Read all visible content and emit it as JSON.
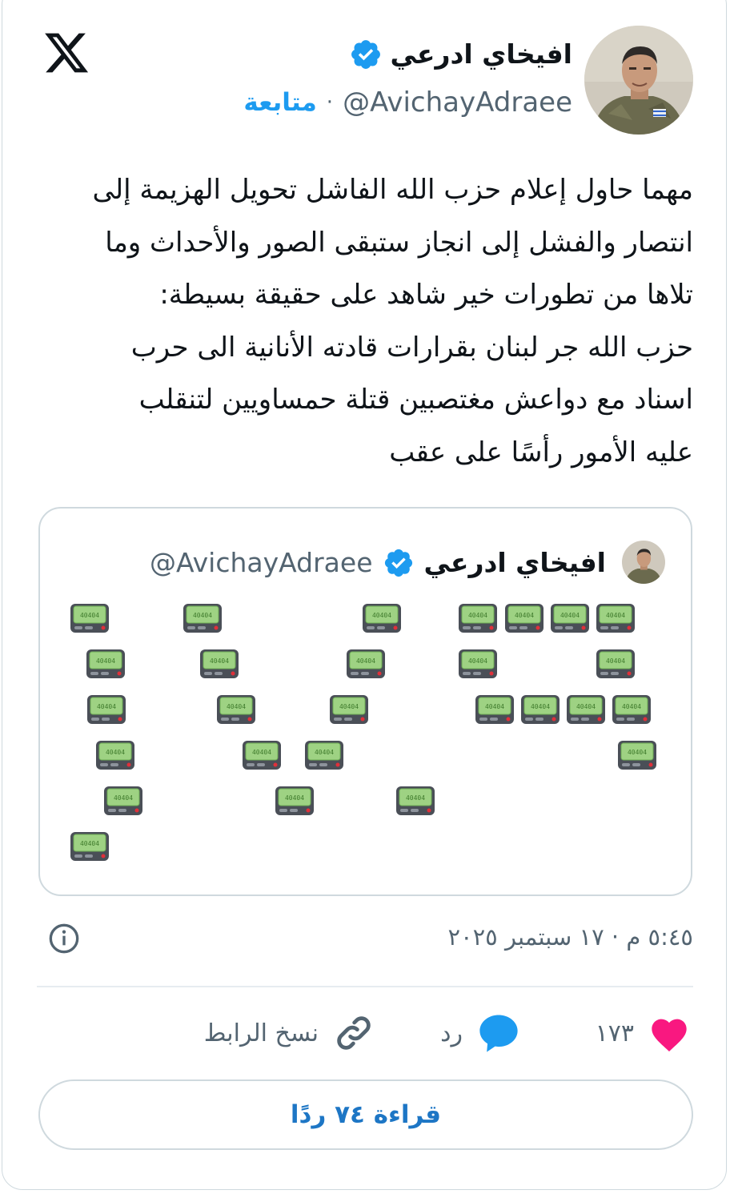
{
  "author": {
    "name": "افيخاي ادرعي",
    "handle": "@AvichayAdraee",
    "follow_label": "متابعة",
    "separator": "·",
    "verified": true
  },
  "tweet_text": "مهما حاول إعلام حزب الله الفاشل تحويل الهزيمة إلى\nانتصار والفشل إلى انجاز ستبقى الصور والأحداث وما\nتلاها من تطورات خير شاهد على حقيقة بسيطة:\nحزب الله جر لبنان بقرارات قادته الأنانية الى حرب\nاسناد مع دواعش مغتصبين قتلة حمساويين لتنقلب\nعليه الأمور رأسًا على عقب",
  "quote": {
    "name": "افيخاي ادرعي",
    "handle": "@AvichayAdraee",
    "pager_label": "40404"
  },
  "timestamp": "٥:٤٥ م · ١٧ سبتمبر ٢٠٢٥",
  "actions": {
    "likes_count": "١٧٣",
    "reply_label": "رد",
    "copy_link_label": "نسخ الرابط"
  },
  "read_replies_label": "قراءة ٧٤ ردًا",
  "colors": {
    "accent": "#1d9bf0",
    "like": "#f91880",
    "pager_screen": "#9ed283",
    "pager_body": "#4a4f57"
  }
}
